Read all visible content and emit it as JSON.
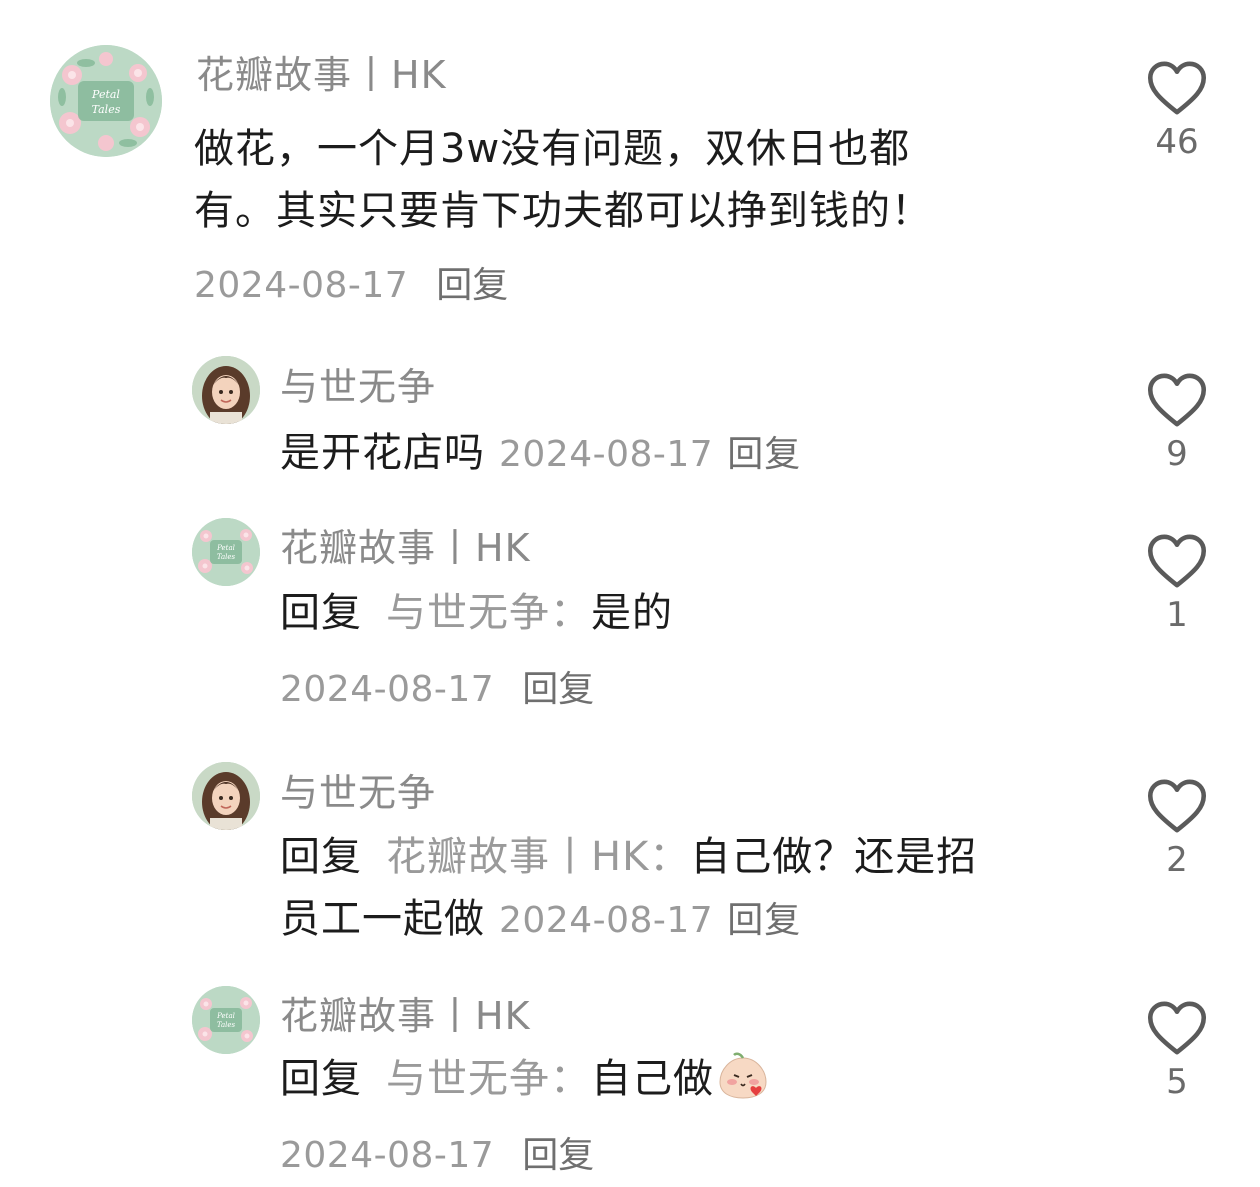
{
  "comments": [
    {
      "author": "花瓣故事丨HK",
      "lines": [
        "做花，一个月3w没有问题，双休日也都",
        "有。其实只要肯下功夫都可以挣到钱的！"
      ],
      "date": "2024-08-17",
      "reply_label": "回复",
      "likes": "46",
      "avatar": "petal-tales-logo"
    },
    {
      "author": "与世无争",
      "text": "是开花店吗",
      "date": "2024-08-17",
      "reply_label": "回复",
      "likes": "9",
      "avatar": "girl-portrait"
    },
    {
      "author": "花瓣故事丨HK",
      "prefix": "回复",
      "target": "与世无争：",
      "text": "是的",
      "date": "2024-08-17",
      "reply_label": "回复",
      "likes": "1",
      "avatar": "petal-tales-logo"
    },
    {
      "author": "与世无争",
      "prefix": "回复",
      "target": "花瓣故事丨HK：",
      "text": "自己做？还是招",
      "text2": "员工一起做",
      "date": "2024-08-17",
      "reply_label": "回复",
      "likes": "2",
      "avatar": "girl-portrait"
    },
    {
      "author": "花瓣故事丨HK",
      "prefix": "回复",
      "target": "与世无争：",
      "text": "自己做",
      "emoji": "blushing-peach-emoji",
      "date": "2024-08-17",
      "reply_label": "回复",
      "likes": "5",
      "avatar": "petal-tales-logo"
    }
  ],
  "avatar_logo": {
    "line1": "Petal",
    "line2": "Tales"
  },
  "colors": {
    "name": "#8a8a8a",
    "text": "#1c1c1c",
    "meta": "#9a9a9a",
    "heart_stroke": "#5a5a5a"
  }
}
